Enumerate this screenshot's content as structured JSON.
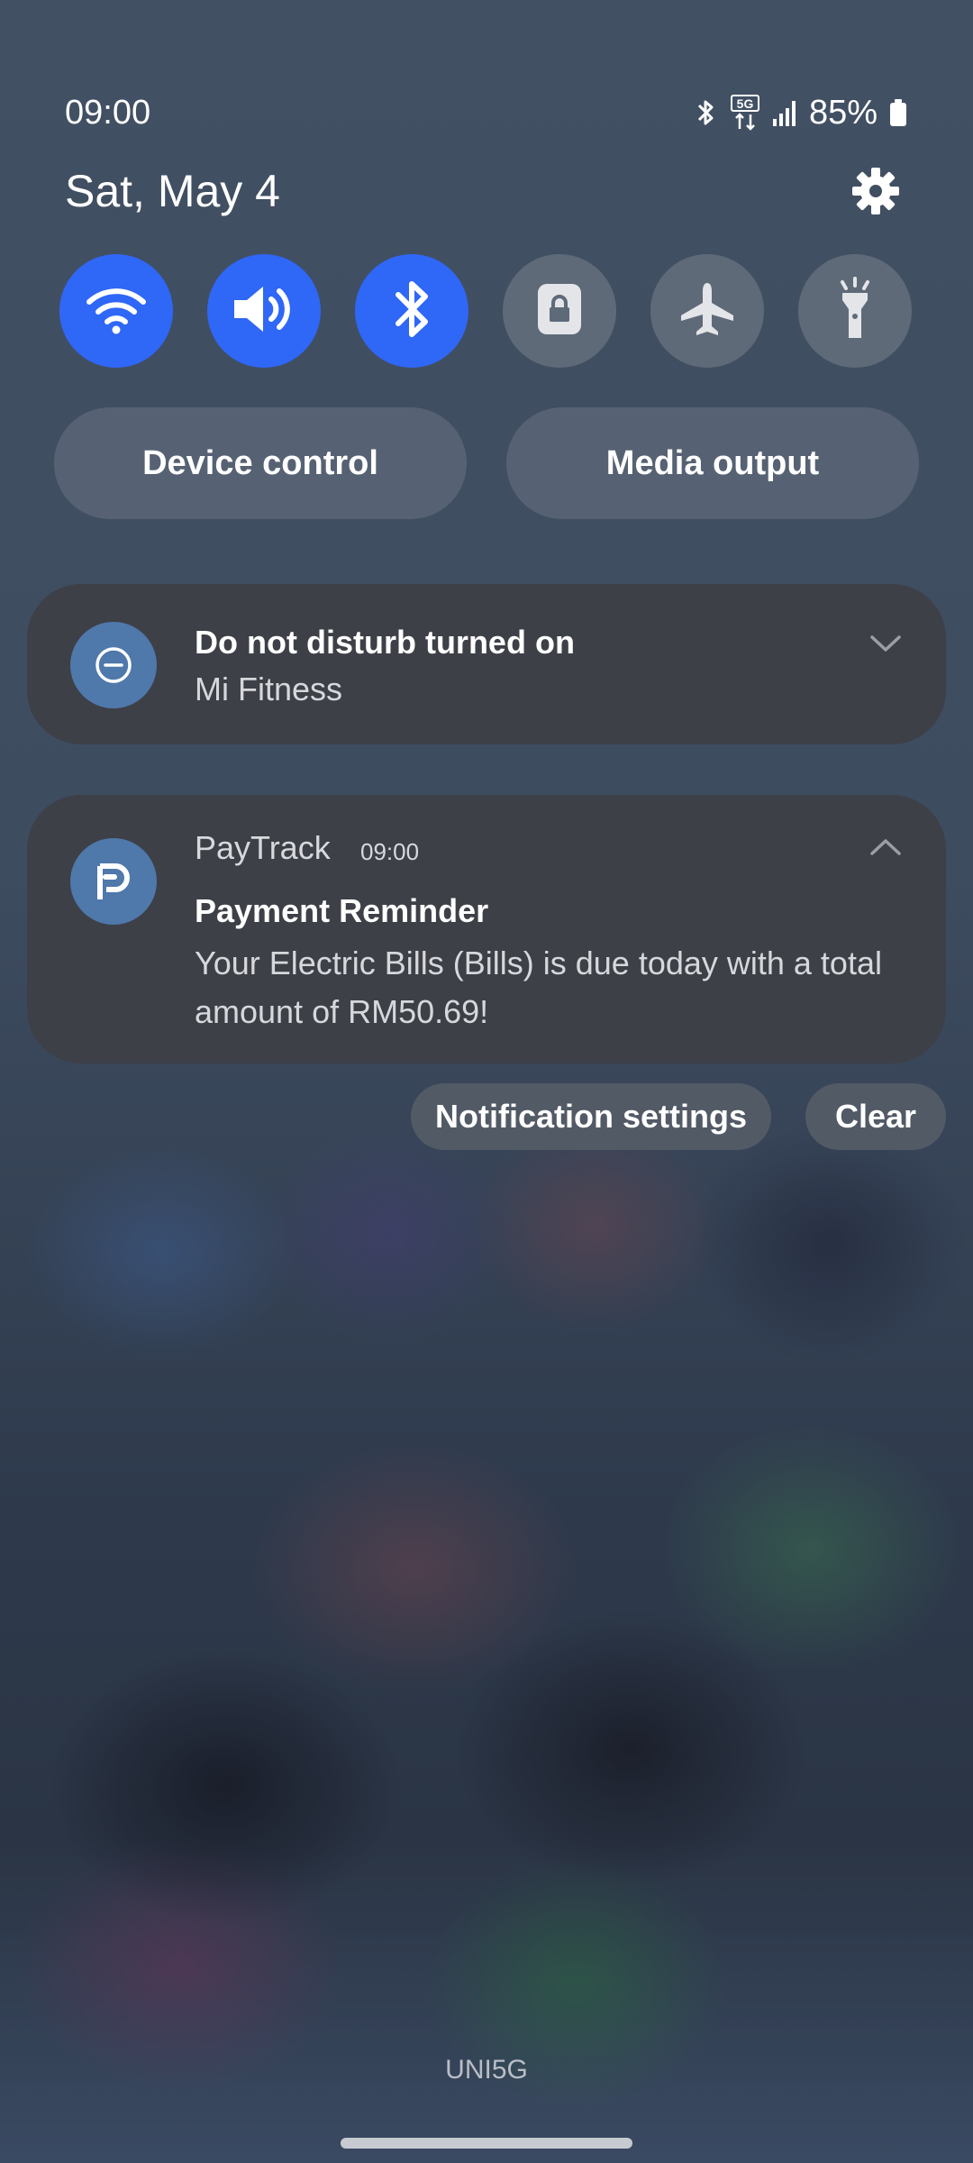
{
  "status_bar": {
    "time": "09:00",
    "battery": "85%",
    "icons": [
      "bluetooth-icon",
      "5g-data-icon",
      "signal-icon",
      "battery-icon"
    ],
    "network_label": "5G"
  },
  "header": {
    "date": "Sat, May 4",
    "settings_icon": "gear-icon"
  },
  "quick_toggles": [
    {
      "icon": "wifi-icon",
      "state": "on"
    },
    {
      "icon": "sound-icon",
      "state": "on"
    },
    {
      "icon": "bluetooth-icon",
      "state": "on"
    },
    {
      "icon": "secure-folder-icon",
      "state": "off"
    },
    {
      "icon": "airplane-icon",
      "state": "off"
    },
    {
      "icon": "flashlight-icon",
      "state": "off"
    }
  ],
  "controls": {
    "device_control": "Device control",
    "media_output": "Media output"
  },
  "notifications": {
    "dnd": {
      "title": "Do not disturb turned on",
      "subtitle": "Mi Fitness",
      "icon": "do-not-disturb-icon"
    },
    "paytrack": {
      "app_name": "PayTrack",
      "time": "09:00",
      "title": "Payment Reminder",
      "body": "Your Electric Bills (Bills) is due today with a total amount of RM50.69!",
      "icon": "paytrack-logo-icon"
    }
  },
  "actions": {
    "notification_settings": "Notification settings",
    "clear": "Clear"
  },
  "footer": {
    "carrier": "UNI5G"
  },
  "colors": {
    "toggle_on": "#2f67f6",
    "toggle_off": "#5f6a79",
    "card_bg": "#3d4047",
    "app_icon_bg": "#4f78ab"
  }
}
